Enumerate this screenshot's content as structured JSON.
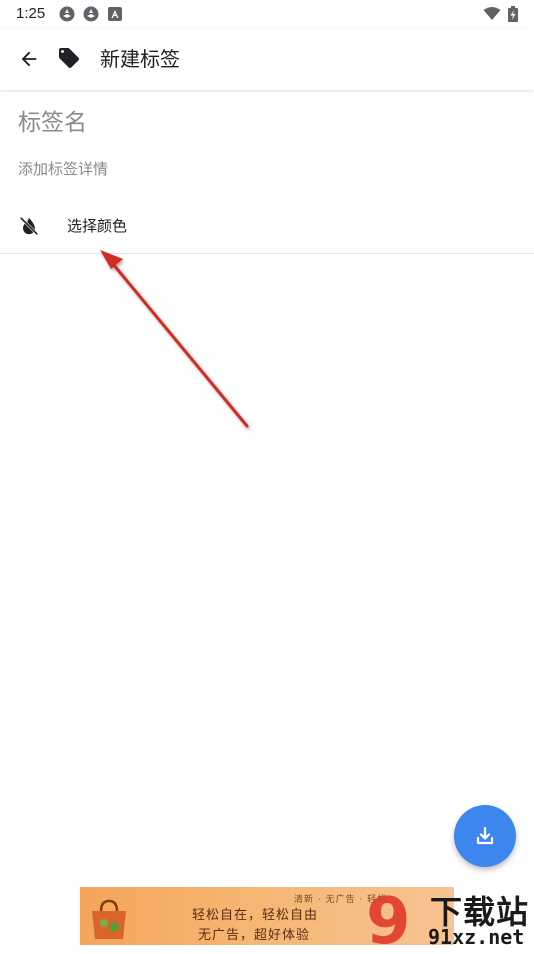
{
  "status_bar": {
    "time": "1:25"
  },
  "app_bar": {
    "title": "新建标签",
    "back_icon": "arrow-left-icon",
    "tag_icon": "tag-icon"
  },
  "form": {
    "name_placeholder": "标签名",
    "detail_placeholder": "添加标签详情",
    "color_label": "选择颜色",
    "color_icon": "color-off-icon"
  },
  "fab": {
    "icon": "download-icon",
    "color": "#3d86ee"
  },
  "ad": {
    "tags": "清新 · 无广告 · 轻松",
    "line1": "轻松自在，轻松自由",
    "line2": "无广告，超好体验"
  },
  "watermark": {
    "brand": "下载站",
    "url": "91xz.net",
    "logo_digits": "9"
  },
  "colors": {
    "accent": "#3d86ee",
    "annotation_arrow": "#d42a24"
  }
}
